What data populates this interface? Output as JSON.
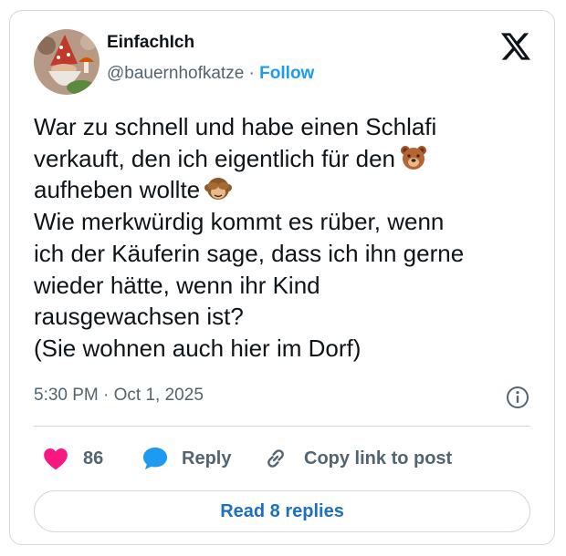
{
  "author": {
    "display_name": "EinfachIch",
    "handle": "@bauernhofkatze",
    "separator": " · ",
    "follow_label": "Follow",
    "avatar_icon": "avatar-gnome-with-red-hat-and-mushroom"
  },
  "brand": {
    "logo_icon": "x-logo-icon"
  },
  "tweet": {
    "lines": [
      "War zu schnell und habe einen Schlafi",
      "verkauft, den ich eigentlich für den",
      "aufheben wollte",
      "Wie merkwürdig kommt es rüber, wenn",
      "ich der Käuferin sage, dass ich ihn gerne",
      "wieder hätte, wenn ihr Kind",
      "rausgewachsen ist?",
      "(Sie wohnen auch hier im Dorf)"
    ],
    "emoji_1": "bear-face-emoji",
    "emoji_2": "see-no-evil-monkey-emoji"
  },
  "meta": {
    "time": "5:30 PM",
    "separator": " · ",
    "date": "Oct 1, 2025",
    "info_icon": "info-icon"
  },
  "actions": {
    "like_count": "86",
    "reply_label": "Reply",
    "copy_label": "Copy link to post"
  },
  "footer": {
    "read_replies_label": "Read 8 replies"
  },
  "colors": {
    "accent_blue": "#1d9bf0",
    "replies_blue": "#1d6fc0",
    "like_pink": "#f91880",
    "text_primary": "#0f1419",
    "text_secondary": "#536471",
    "border": "#cfd9de"
  }
}
